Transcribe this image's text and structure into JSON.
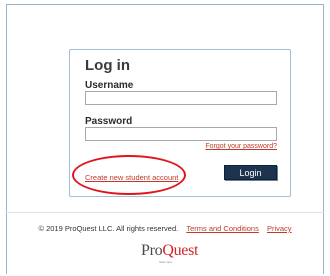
{
  "login": {
    "title": "Log in",
    "username_label": "Username",
    "username_value": "",
    "password_label": "Password",
    "password_value": "",
    "forgot_link": "Forgot your password?",
    "create_account_link": "Create new student account",
    "login_button": "Login"
  },
  "footer": {
    "copyright": "© 2019 ProQuest LLC. All rights reserved.",
    "terms_link": "Terms and Conditions",
    "privacy_link": "Privacy"
  },
  "logo": {
    "brand_part1": "Pro",
    "brand_part2": "Quest",
    "tagline": "Start here."
  },
  "colors": {
    "link": "#c0392b",
    "button_bg": "#1c3450",
    "highlight_oval": "#e0161b",
    "box_border": "#9fc0dc"
  }
}
